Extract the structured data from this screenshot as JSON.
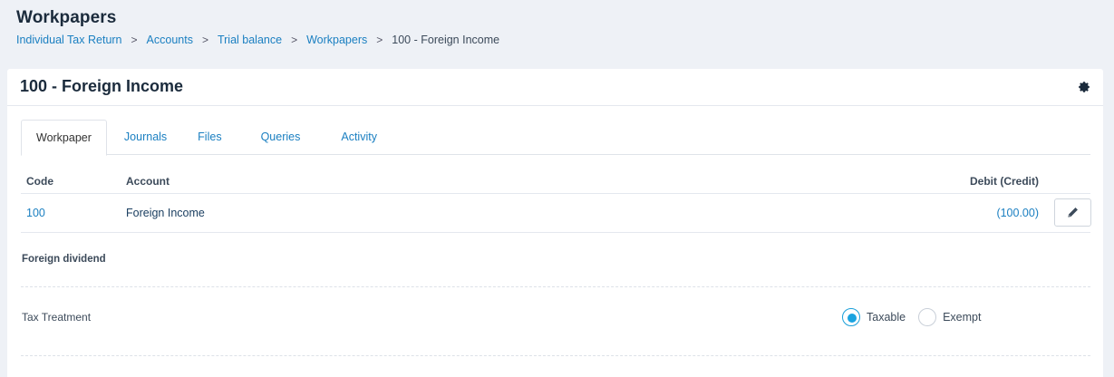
{
  "page": {
    "title": "Workpapers"
  },
  "breadcrumb": {
    "items": [
      "Individual Tax Return",
      "Accounts",
      "Trial balance",
      "Workpapers"
    ],
    "separator": ">",
    "current": "100 - Foreign Income"
  },
  "card": {
    "title": "100 - Foreign Income",
    "settings_icon": "gear-icon"
  },
  "tabs": [
    {
      "label": "Workpaper",
      "active": true
    },
    {
      "label": "Journals",
      "active": false
    },
    {
      "label": "Files",
      "active": false
    },
    {
      "label": "Queries",
      "active": false
    },
    {
      "label": "Activity",
      "active": false
    }
  ],
  "table": {
    "headers": {
      "code": "Code",
      "account": "Account",
      "amount": "Debit (Credit)"
    },
    "rows": [
      {
        "code": "100",
        "account": "Foreign Income",
        "amount": "(100.00)",
        "action_icon": "pencil-icon"
      }
    ]
  },
  "section": {
    "title": "Foreign dividend",
    "tax_treatment": {
      "label": "Tax Treatment",
      "options": [
        {
          "label": "Taxable",
          "selected": true
        },
        {
          "label": "Exempt",
          "selected": false
        }
      ]
    }
  },
  "colors": {
    "link": "#1a7fc1",
    "radio_accent": "#1aa3e0",
    "background": "#eef1f6"
  }
}
